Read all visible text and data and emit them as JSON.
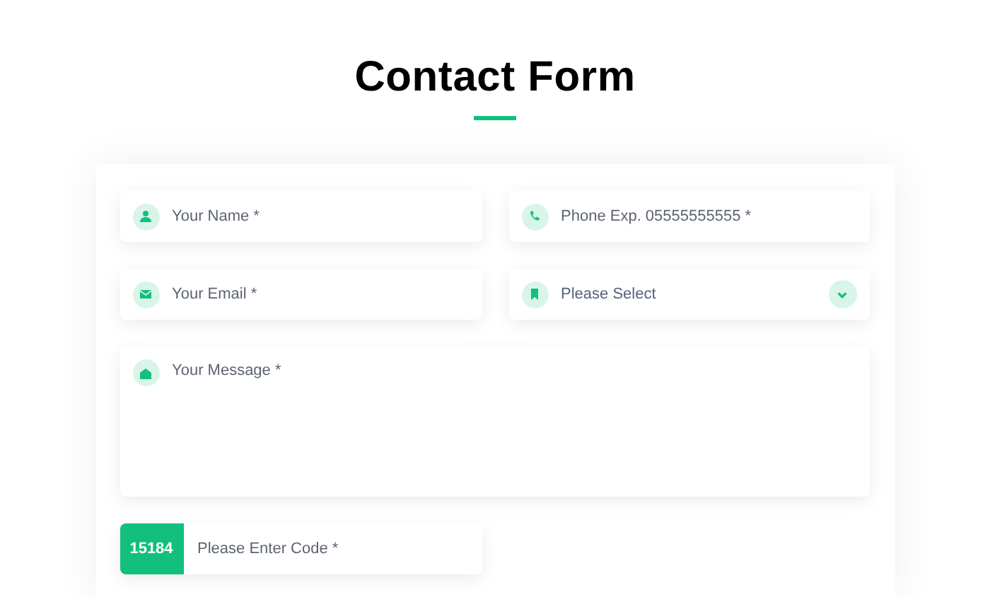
{
  "title": "Contact Form",
  "fields": [
    {
      "kind": "text",
      "placeholder": "Your Name *"
    },
    {
      "kind": "text",
      "placeholder": "Phone Exp. 05555555555 *"
    },
    {
      "kind": "text",
      "placeholder": "Your Email *"
    },
    {
      "kind": "select",
      "value": "Please Select"
    },
    {
      "kind": "textarea",
      "placeholder": "Your Message *"
    }
  ],
  "captcha": {
    "code": "15184",
    "placeholder": "Please Enter Code *"
  }
}
